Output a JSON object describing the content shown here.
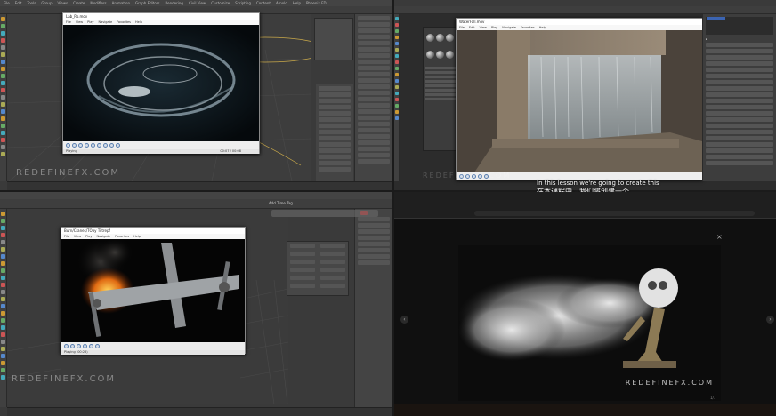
{
  "q1": {
    "menu": [
      "File",
      "Edit",
      "Tools",
      "Group",
      "Views",
      "Create",
      "Modifiers",
      "Animation",
      "Graph Editors",
      "Rendering",
      "Civil View",
      "Customize",
      "Scripting",
      "Content",
      "Arnold",
      "Help",
      "Phoenix FD"
    ],
    "player": {
      "title": "Lab_Ro.mov",
      "menu": [
        "File",
        "View",
        "Play",
        "Navigate",
        "Favorites",
        "Help"
      ],
      "status_left": "Playing",
      "status_right": "00:07 / 00:08"
    },
    "watermark": "REDEFINEFX.COM"
  },
  "q2": {
    "player": {
      "title": "WaterFall.mov",
      "menu": [
        "File",
        "Edit",
        "View",
        "Play",
        "Navigate",
        "Favorites",
        "Help"
      ]
    },
    "subtitle_en": "In this lesson we're going to create this",
    "subtitle_zh": "在本课程中，我们将创建一个",
    "watermark": "REDEFINEFX.COM"
  },
  "q3": {
    "player": {
      "title": "Burn/Cranes/TOby Tiltrepf",
      "menu": [
        "File",
        "View",
        "Play",
        "Navigate",
        "Favorites",
        "Help"
      ],
      "status_left": "Playing (00:28)"
    },
    "watermark": "REDEFINEFX.COM",
    "toolbar_label": "Add Time Tag"
  },
  "q4": {
    "watermark": "REDEFINEFX.COM",
    "close": "×",
    "prev": "‹",
    "next": "›",
    "counter": "1/7"
  }
}
